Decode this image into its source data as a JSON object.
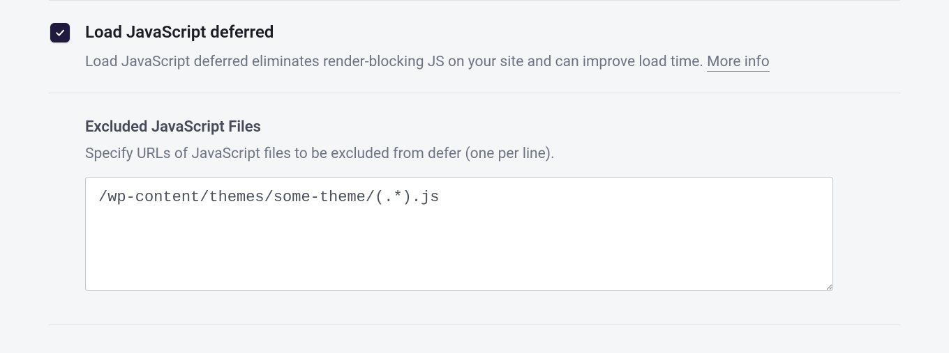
{
  "option": {
    "checked": true,
    "title": "Load JavaScript deferred",
    "description": "Load JavaScript deferred eliminates render-blocking JS on your site and can improve load time. ",
    "more_info_label": "More info"
  },
  "excluded": {
    "title": "Excluded JavaScript Files",
    "description": "Specify URLs of JavaScript files to be excluded from defer (one per line).",
    "value": "/wp-content/themes/some-theme/(.*).js"
  }
}
